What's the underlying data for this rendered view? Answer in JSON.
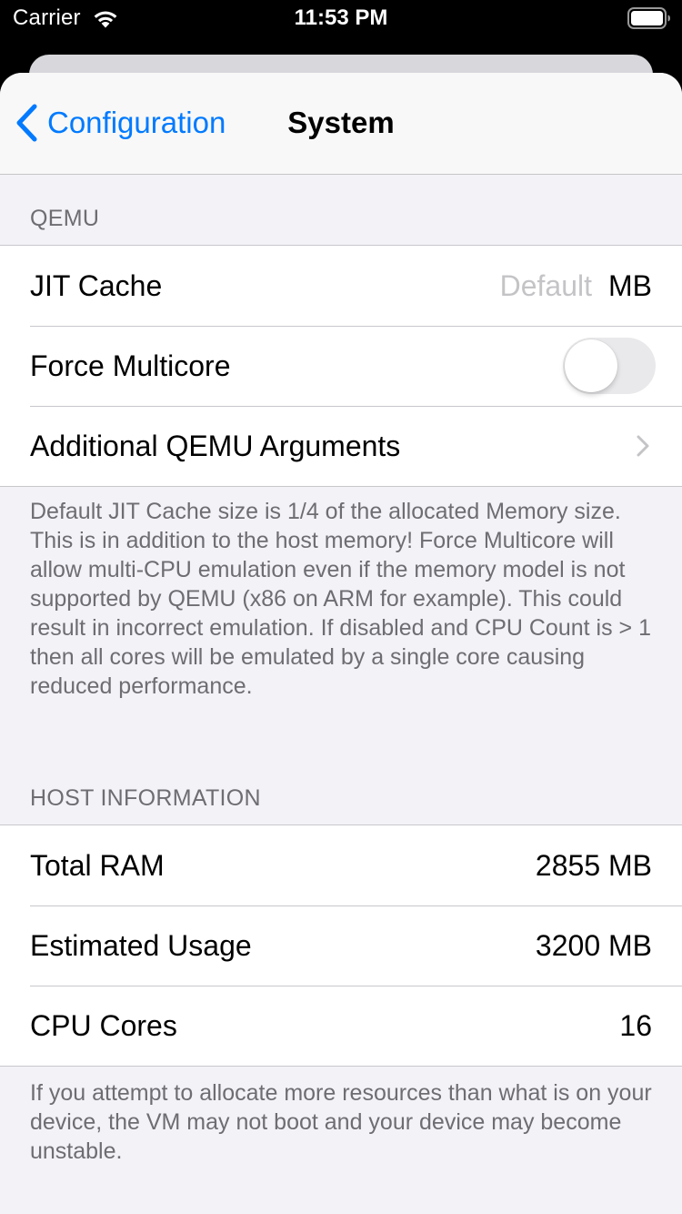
{
  "status_bar": {
    "carrier": "Carrier",
    "time": "11:53 PM",
    "wifi_icon": "wifi-icon",
    "battery_icon": "battery-icon"
  },
  "nav": {
    "back_label": "Configuration",
    "title": "System",
    "accent_color": "#007aff"
  },
  "qemu_section": {
    "header": "QEMU",
    "jit_cache": {
      "label": "JIT Cache",
      "value": "",
      "placeholder": "Default",
      "unit": "MB"
    },
    "force_multicore": {
      "label": "Force Multicore",
      "enabled": false
    },
    "additional_args": {
      "label": "Additional QEMU Arguments"
    },
    "footer": "Default JIT Cache size is 1/4 of the allocated Memory size. This is in addition to the host memory! Force Multicore will allow multi-CPU emulation even if the memory model is not supported by QEMU (x86 on ARM for example). This could result in incorrect emulation. If disabled and CPU Count is > 1 then all cores will be emulated by a single core causing reduced performance."
  },
  "host_section": {
    "header": "HOST INFORMATION",
    "rows": [
      {
        "label": "Total RAM",
        "value": "2855 MB"
      },
      {
        "label": "Estimated Usage",
        "value": "3200 MB"
      },
      {
        "label": "CPU Cores",
        "value": "16"
      }
    ],
    "footer": "If you attempt to allocate more resources than what is on your device, the VM may not boot and your device may become unstable."
  }
}
